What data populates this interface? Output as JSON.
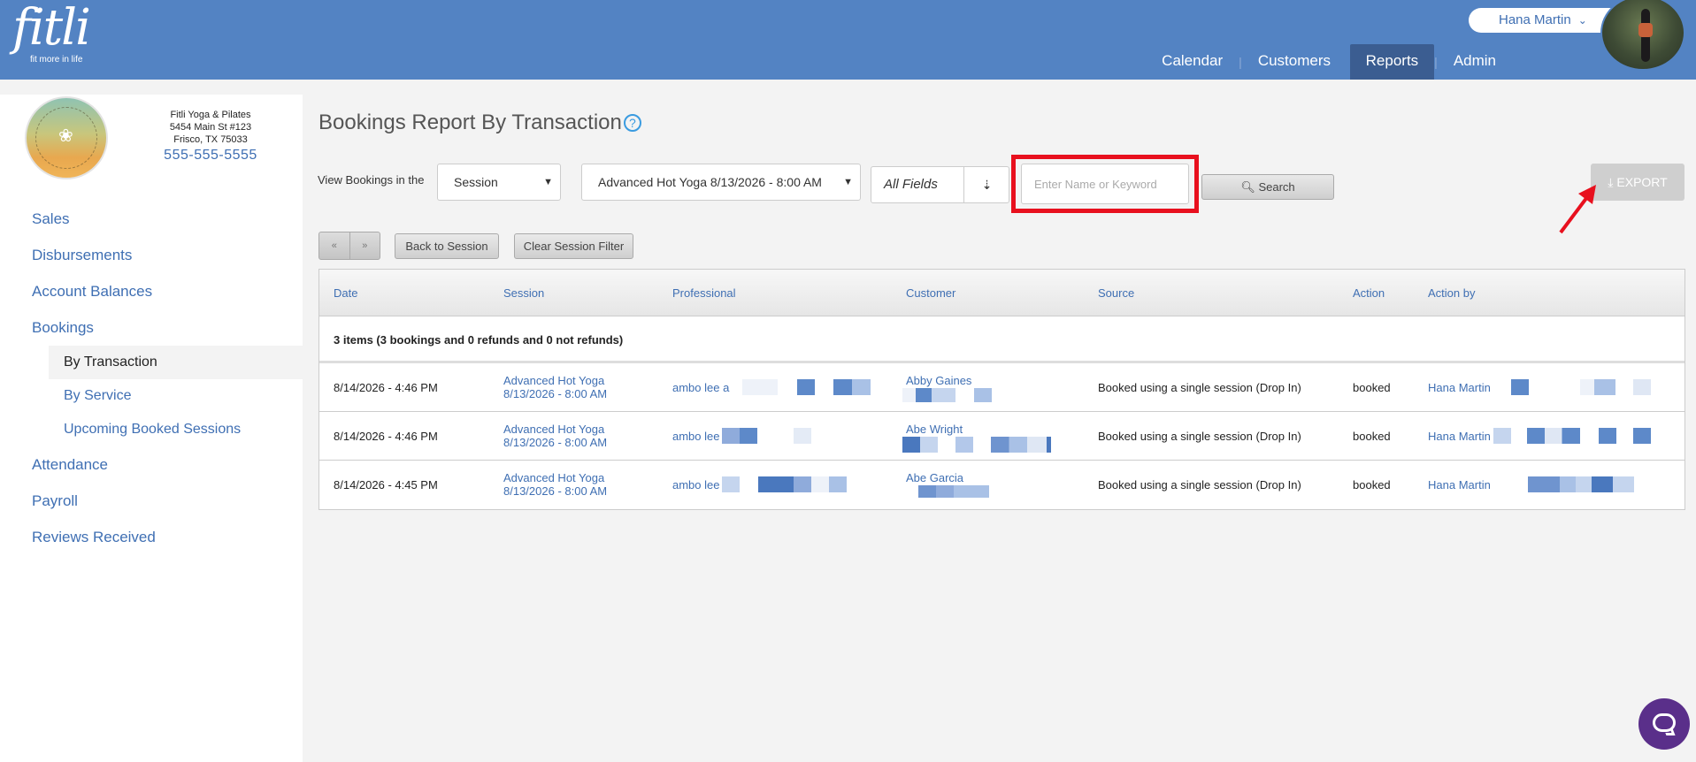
{
  "header": {
    "logo_text": "fitli",
    "logo_tagline": "fit more in life",
    "user_name": "Hana Martin",
    "nav": [
      "Calendar",
      "Customers",
      "Reports",
      "Admin"
    ]
  },
  "studio": {
    "name": "Fitli Yoga & Pilates",
    "address1": "5454 Main St #123",
    "address2": "Frisco, TX 75033",
    "phone": "555-555-5555"
  },
  "sidebar": {
    "items": [
      "Sales",
      "Disbursements",
      "Account Balances",
      "Bookings",
      "Attendance",
      "Payroll",
      "Reviews Received"
    ],
    "bookings_sub": [
      "By Transaction",
      "By Service",
      "Upcoming Booked Sessions"
    ]
  },
  "page": {
    "title": "Bookings Report By Transaction",
    "help": "?",
    "view_label": "View Bookings in the",
    "scope_select": "Session",
    "session_select": "Advanced Hot Yoga 8/13/2026 - 8:00 AM",
    "fields_select": "All Fields",
    "search_placeholder": "Enter Name or Keyword",
    "search_button": "Search",
    "export_button": "EXPORT",
    "pager_prev": "«",
    "pager_next": "»",
    "back_button": "Back to Session",
    "clear_button": "Clear Session Filter"
  },
  "table": {
    "columns": [
      "Date",
      "Session",
      "Professional",
      "Customer",
      "Source",
      "Action",
      "Action by"
    ],
    "summary": "3 items (3 bookings and 0 refunds and 0 not refunds)",
    "rows": [
      {
        "date": "8/14/2026 - 4:46 PM",
        "session1": "Advanced Hot Yoga",
        "session2": "8/13/2026 - 8:00 AM",
        "professional": "ambo lee a",
        "customer": "Abby Gaines",
        "source": "Booked using a single session (Drop In)",
        "action": "booked",
        "action_by": "Hana Martin"
      },
      {
        "date": "8/14/2026 - 4:46 PM",
        "session1": "Advanced Hot Yoga",
        "session2": "8/13/2026 - 8:00 AM",
        "professional": "ambo lee",
        "customer": "Abe Wright",
        "source": "Booked using a single session (Drop In)",
        "action": "booked",
        "action_by": "Hana Martin"
      },
      {
        "date": "8/14/2026 - 4:45 PM",
        "session1": "Advanced Hot Yoga",
        "session2": "8/13/2026 - 8:00 AM",
        "professional": "ambo lee",
        "customer": "Abe Garcia",
        "source": "Booked using a single session (Drop In)",
        "action": "booked",
        "action_by": "Hana Martin"
      }
    ]
  },
  "colors": {
    "header_bg": "#5383c3",
    "nav_active": "#3b5d91",
    "link": "#3f6fb3",
    "highlight": "#e8101e",
    "chat": "#5a2f8a"
  },
  "icons": [
    "search-icon",
    "download-icon",
    "chevron-down-icon",
    "double-chevron-down-icon",
    "help-icon",
    "chat-icon"
  ]
}
